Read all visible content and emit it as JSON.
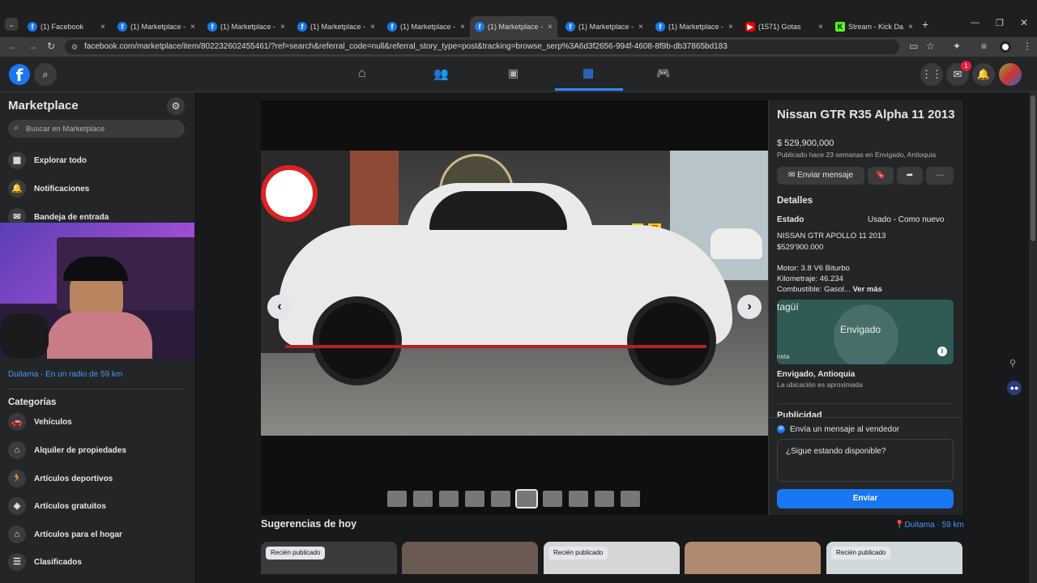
{
  "browser": {
    "tabs": [
      {
        "label": "(1) Facebook",
        "icon": "facebook-icon"
      },
      {
        "label": "(1) Marketplace -",
        "icon": "facebook-icon"
      },
      {
        "label": "(1) Marketplace -",
        "icon": "facebook-icon"
      },
      {
        "label": "(1) Marketplace -",
        "icon": "facebook-icon"
      },
      {
        "label": "(1) Marketplace -",
        "icon": "facebook-icon"
      },
      {
        "label": "(1) Marketplace -",
        "icon": "facebook-icon"
      },
      {
        "label": "(1) Marketplace -",
        "icon": "facebook-icon"
      },
      {
        "label": "(1) Marketplace -",
        "icon": "facebook-icon"
      },
      {
        "label": "(1571) Gotas",
        "icon": "youtube-icon"
      },
      {
        "label": "Stream - Kick Da",
        "icon": "kick-icon"
      }
    ],
    "url": "facebook.com/marketplace/item/802232602455461/?ref=search&referral_code=null&referral_story_type=post&tracking=browse_serp%3A6d3f2656-994f-4608-8f9b-db37865bd183"
  },
  "fb": {
    "notif_count": "1"
  },
  "sidebar": {
    "title": "Marketplace",
    "search_placeholder": "Buscar en Marketplace",
    "items": [
      {
        "label": "Explorar todo",
        "icon": "store-icon"
      },
      {
        "label": "Notificaciones",
        "icon": "bell-icon"
      },
      {
        "label": "Bandeja de entrada",
        "icon": "inbox-icon"
      }
    ],
    "location": "Duitama · En un radio de 59 km",
    "categories_title": "Categorías",
    "categories": [
      {
        "label": "Vehículos",
        "icon": "car-icon"
      },
      {
        "label": "Alquiler de propiedades",
        "icon": "house-icon"
      },
      {
        "label": "Artículos deportivos",
        "icon": "run-icon"
      },
      {
        "label": "Artículos gratuitos",
        "icon": "tag-icon"
      },
      {
        "label": "Artículos para el hogar",
        "icon": "home-icon"
      },
      {
        "label": "Clasificados",
        "icon": "list-icon"
      }
    ]
  },
  "listing": {
    "title": "Nissan GTR R35 Alpha 11 2013",
    "price": "$ 529,900,000",
    "published": "Publicado hace 23 semanas en Envigado, Antioquia",
    "send_message": "Enviar mensaje",
    "details_title": "Detalles",
    "state_label": "Estado",
    "state_value": "Usado - Como nuevo",
    "desc_line1": "NISSAN GTR APOLLO 11 2013",
    "desc_line2": "$529'900.000",
    "motor": "Motor: 3.8 V6 Biturbo",
    "km": "Kilometraje: 46.234",
    "fuel": "Combustible: Gasol...",
    "see_more": "Ver más",
    "map_city": "Envigado",
    "map_left": "tagüí",
    "map_bottom": "neta",
    "location": "Envigado, Antioquia",
    "location_note": "La ubicación es aproximada",
    "ads_title": "Publicidad",
    "msg_seller": "Envía un mensaje al vendedor",
    "msg_text": "¿Sigue estando disponible?",
    "send": "Enviar"
  },
  "suggestions": {
    "title": "Sugerencias de hoy",
    "location": "Duitama · 59 km",
    "badge": "Recién publicado"
  },
  "photo_signs": {
    "sign1": "72",
    "sign2": "73"
  }
}
